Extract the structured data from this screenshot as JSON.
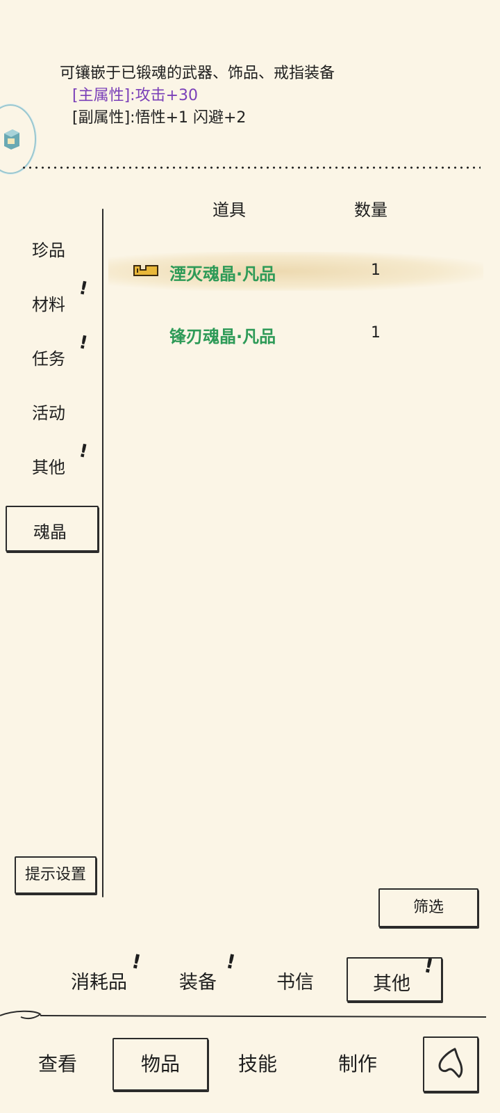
{
  "description": {
    "text": "可镶嵌于已锻魂的武器、饰品、戒指装备",
    "main_attr": "[主属性]:攻击+30",
    "sub_attr": "[副属性]:悟性+1 闪避+2"
  },
  "categories": [
    {
      "label": "珍品",
      "alert": false
    },
    {
      "label": "材料",
      "alert": true
    },
    {
      "label": "任务",
      "alert": true
    },
    {
      "label": "活动",
      "alert": false
    },
    {
      "label": "其他",
      "alert": true
    },
    {
      "label": "魂晶",
      "alert": false,
      "selected": true
    }
  ],
  "alert_mark": "!",
  "table": {
    "headers": {
      "item": "道具",
      "qty": "数量"
    },
    "rows": [
      {
        "name": "湮灭魂晶·凡品",
        "qty": "1",
        "selected": true
      },
      {
        "name": "锋刃魂晶·凡品",
        "qty": "1",
        "selected": false
      }
    ]
  },
  "hint_settings_label": "提示设置",
  "filter_label": "筛选",
  "sub_tabs": [
    {
      "label": "消耗品",
      "alert": true
    },
    {
      "label": "装备",
      "alert": true
    },
    {
      "label": "书信",
      "alert": false
    },
    {
      "label": "其他",
      "alert": true,
      "selected": true
    }
  ],
  "nav_tabs": [
    {
      "label": "查看"
    },
    {
      "label": "物品",
      "selected": true
    },
    {
      "label": "技能"
    },
    {
      "label": "制作"
    }
  ],
  "colors": {
    "background": "#fbf5e6",
    "item_green": "#2d9a57",
    "main_attr_purple": "#7a3fb8"
  }
}
